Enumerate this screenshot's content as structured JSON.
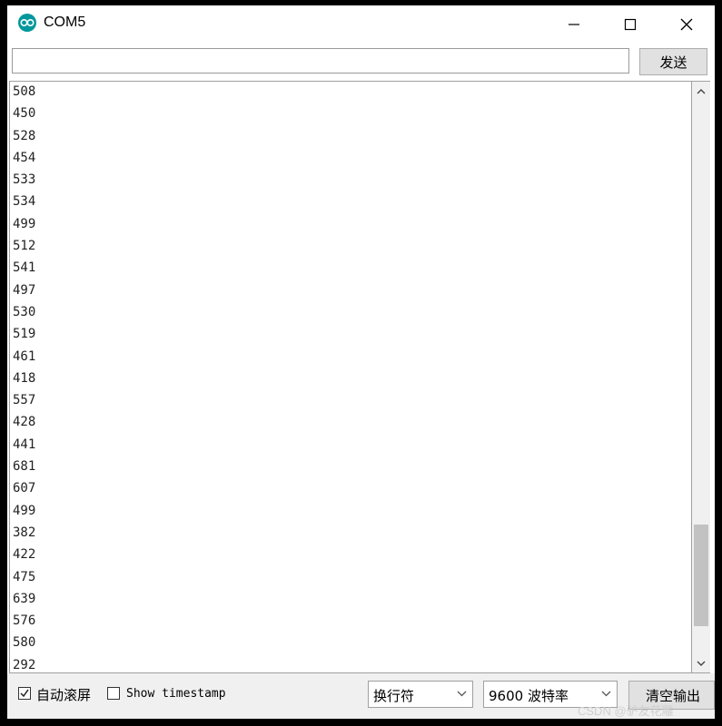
{
  "window": {
    "title": "COM5",
    "icon": "arduino-icon",
    "controls": [
      "minimize-icon",
      "maximize-icon",
      "close-icon"
    ]
  },
  "input_row": {
    "send_value": "",
    "send_label": "发送"
  },
  "output": {
    "lines": [
      "508",
      "450",
      "528",
      "454",
      "533",
      "534",
      "499",
      "512",
      "541",
      "497",
      "530",
      "519",
      "461",
      "418",
      "557",
      "428",
      "441",
      "681",
      "607",
      "499",
      "382",
      "422",
      "475",
      "639",
      "576",
      "580",
      "292"
    ]
  },
  "bottom_bar": {
    "autoscroll_label": "自动滚屏",
    "autoscroll_checked": true,
    "timestamp_label": "Show timestamp",
    "timestamp_checked": false,
    "line_ending": "换行符",
    "baud_rate": "9600 波特率",
    "clear_label": "清空输出"
  },
  "watermark": "CSDN @驴友花雕",
  "colors": {
    "accent": "#00979c",
    "button": "#e1e1e1",
    "background": "#f0f0f0"
  }
}
